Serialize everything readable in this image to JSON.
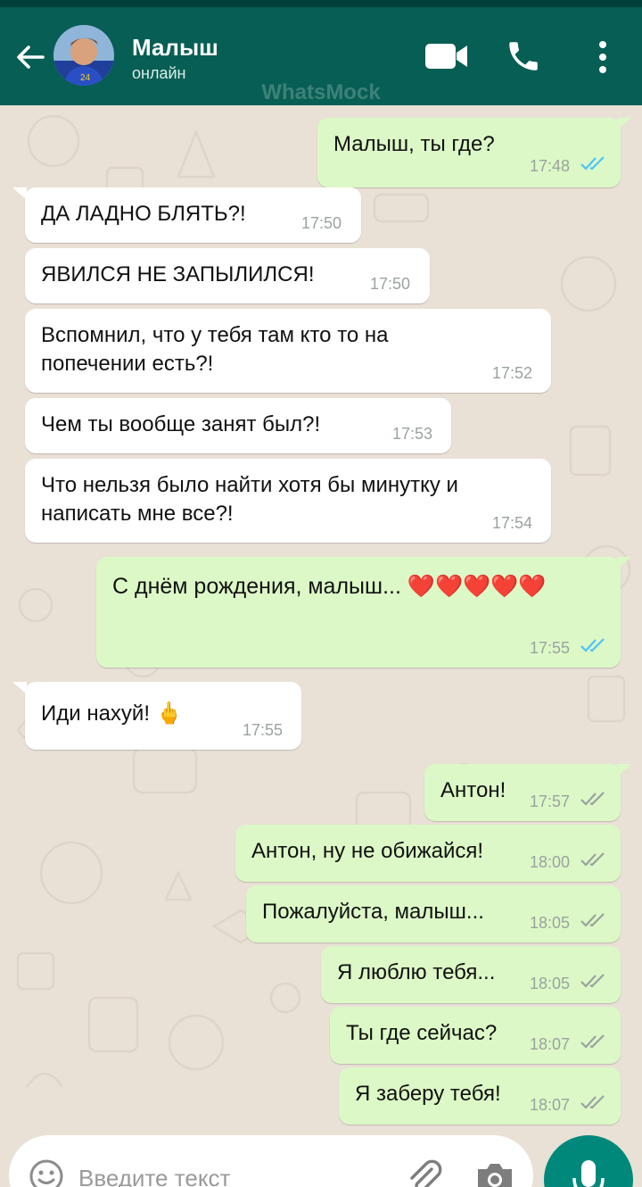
{
  "header": {
    "contact_name": "Малыш",
    "contact_status": "онлайн",
    "watermark": "WhatsMock"
  },
  "messages": [
    {
      "dir": "out",
      "text": "Малыш, ты где?",
      "time": "17:48",
      "status": "read"
    },
    {
      "dir": "in",
      "text": "ДА ЛАДНО БЛЯТЬ?!",
      "time": "17:50"
    },
    {
      "dir": "in",
      "text": "ЯВИЛСЯ НЕ ЗАПЫЛИЛСЯ!",
      "time": "17:50"
    },
    {
      "dir": "in",
      "text": "Вспомнил, что у тебя там кто то на попечении есть?!",
      "time": "17:52"
    },
    {
      "dir": "in",
      "text": "Чем ты вообще занят был?!",
      "time": "17:53"
    },
    {
      "dir": "in",
      "text": "Что нельзя было найти хотя бы минутку и написать мне все?!",
      "time": "17:54"
    },
    {
      "dir": "out",
      "text": "С днём рождения, малыш... ❤️❤️❤️❤️❤️",
      "time": "17:55",
      "status": "read"
    },
    {
      "dir": "in",
      "text": "Иди нахуй! 🖕",
      "time": "17:55"
    },
    {
      "dir": "out",
      "text": "Антон!",
      "time": "17:57",
      "status": "delivered"
    },
    {
      "dir": "out",
      "text": "Антон, ну не обижайся!",
      "time": "18:00",
      "status": "delivered"
    },
    {
      "dir": "out",
      "text": "Пожалуйста, малыш...",
      "time": "18:05",
      "status": "delivered"
    },
    {
      "dir": "out",
      "text": "Я люблю тебя...",
      "time": "18:05",
      "status": "delivered"
    },
    {
      "dir": "out",
      "text": "Ты где сейчас?",
      "time": "18:07",
      "status": "delivered"
    },
    {
      "dir": "out",
      "text": "Я заберу тебя!",
      "time": "18:07",
      "status": "delivered"
    }
  ],
  "composer": {
    "placeholder": "Введите текст"
  },
  "icons": {
    "back": "arrow-left-icon",
    "video": "video-camera-icon",
    "call": "phone-icon",
    "menu": "more-vertical-icon",
    "emoji": "smiley-icon",
    "attach": "paperclip-icon",
    "camera": "camera-icon",
    "mic": "microphone-icon"
  },
  "colors": {
    "header": "#075e54",
    "outgoing_bubble": "#dcf8c6",
    "incoming_bubble": "#ffffff",
    "read_ticks": "#4fc3f7",
    "delivered_ticks": "#9aa3a0",
    "chat_background": "#e9e1d6",
    "mic_button": "#00897b"
  }
}
